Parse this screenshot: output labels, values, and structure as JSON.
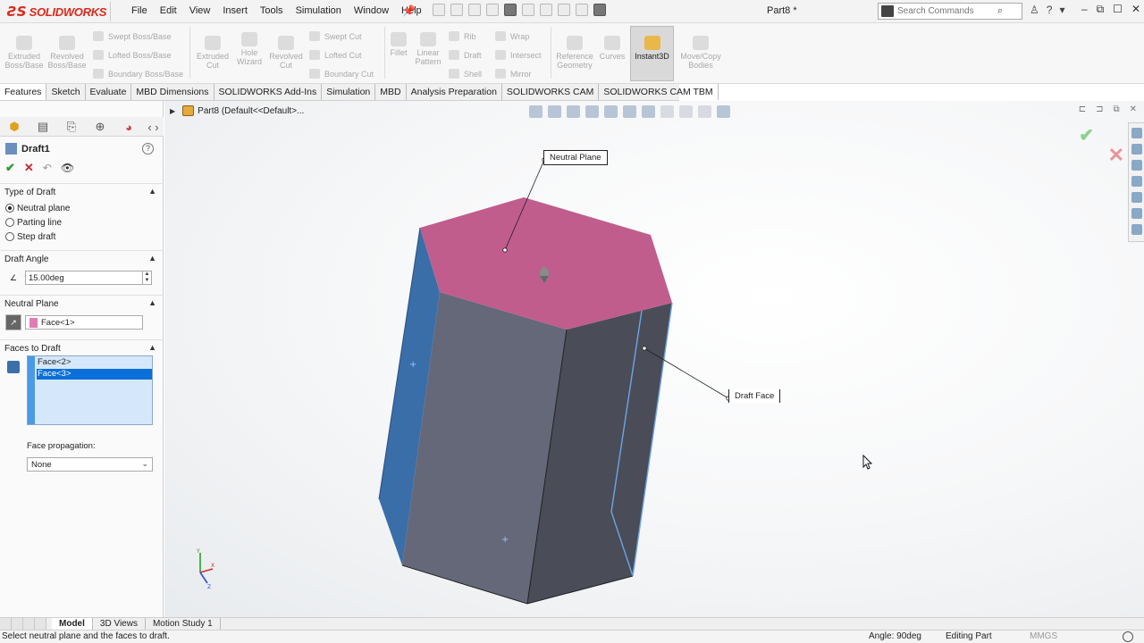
{
  "app": {
    "brand": "SOLIDWORKS",
    "doc_title": "Part8 *",
    "menus": [
      "File",
      "Edit",
      "View",
      "Insert",
      "Tools",
      "Simulation",
      "Window",
      "Help"
    ],
    "search_placeholder": "Search Commands"
  },
  "command_manager": {
    "extruded_boss": "Extruded Boss/Base",
    "revolved_boss": "Revolved Boss/Base",
    "swept_boss": "Swept Boss/Base",
    "lofted_boss": "Lofted Boss/Base",
    "boundary_boss": "Boundary Boss/Base",
    "extruded_cut": "Extruded Cut",
    "hole_wizard": "Hole Wizard",
    "revolved_cut": "Revolved Cut",
    "swept_cut": "Swept Cut",
    "lofted_cut": "Lofted Cut",
    "boundary_cut": "Boundary Cut",
    "fillet": "Fillet",
    "linear_pattern": "Linear Pattern",
    "rib": "Rib",
    "draft": "Draft",
    "shell": "Shell",
    "wrap": "Wrap",
    "intersect": "Intersect",
    "mirror": "Mirror",
    "reference_geometry": "Reference Geometry",
    "curves": "Curves",
    "instant3d": "Instant3D",
    "move_copy": "Move/Copy Bodies"
  },
  "tabs": [
    "Features",
    "Sketch",
    "Evaluate",
    "MBD Dimensions",
    "SOLIDWORKS Add-Ins",
    "Simulation",
    "MBD",
    "Analysis Preparation",
    "SOLIDWORKS CAM",
    "SOLIDWORKS CAM TBM"
  ],
  "property_manager": {
    "title": "Draft1",
    "type_of_draft": {
      "heading": "Type of Draft",
      "options": [
        "Neutral plane",
        "Parting line",
        "Step draft"
      ],
      "selected": "Neutral plane"
    },
    "draft_angle": {
      "heading": "Draft Angle",
      "value": "15.00deg"
    },
    "neutral_plane": {
      "heading": "Neutral Plane",
      "value": "Face<1>"
    },
    "faces_to_draft": {
      "heading": "Faces to Draft",
      "items": [
        "Face<2>",
        "Face<3>"
      ],
      "selected_index": 1,
      "propagation_label": "Face propagation:",
      "propagation_value": "None"
    }
  },
  "viewport": {
    "breadcrumb": "Part8  (Default<<Default>...",
    "callouts": {
      "neutral_plane": "Neutral Plane",
      "draft_face": "Draft Face"
    },
    "colors": {
      "top_face": "#c05d8d",
      "draft_face": "#3a6ea8",
      "body": "#656879"
    }
  },
  "bottom_tabs": [
    "Model",
    "3D Views",
    "Motion Study 1"
  ],
  "status": {
    "message": "Select neutral plane and the faces to draft.",
    "angle": "Angle: 90deg",
    "mode": "Editing Part",
    "units": "MMGS"
  }
}
